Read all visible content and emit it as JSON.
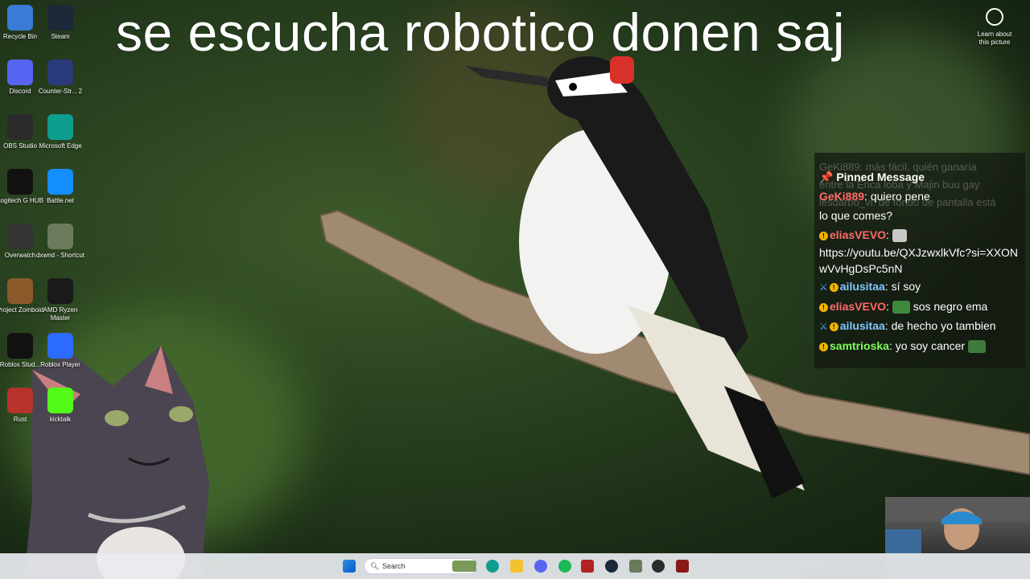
{
  "caption": "se escucha robotico donen saj",
  "learn_about": "Learn about this picture",
  "desktop_icons": [
    {
      "label": "Recycle Bin",
      "icon": "recycle-bin-icon",
      "color": "#3a7bd5"
    },
    {
      "label": "Steam",
      "icon": "steam-icon",
      "color": "#1b2838"
    },
    {
      "label": "Discord",
      "icon": "discord-icon",
      "color": "#5865f2"
    },
    {
      "label": "Counter-Str... 2",
      "icon": "counter-strike-icon",
      "color": "#2a3a7a"
    },
    {
      "label": "OBS Studio",
      "icon": "obs-icon",
      "color": "#2b2b2b"
    },
    {
      "label": "Microsoft Edge",
      "icon": "edge-icon",
      "color": "#0f9d8f"
    },
    {
      "label": "Logitech G HUB",
      "icon": "logitech-icon",
      "color": "#111111"
    },
    {
      "label": "Battle.net",
      "icon": "battlenet-icon",
      "color": "#148eff"
    },
    {
      "label": "Overwatch",
      "icon": "overwatch-icon",
      "color": "#333333"
    },
    {
      "label": "dxwnd - Shortcut",
      "icon": "dxwnd-icon",
      "color": "#6a7a5a"
    },
    {
      "label": "Project Zomboid",
      "icon": "zomboid-icon",
      "color": "#8a5a2a"
    },
    {
      "label": "AMD Ryzen Master",
      "icon": "ryzen-icon",
      "color": "#1a1a1a"
    },
    {
      "label": "Roblox Stud...",
      "icon": "roblox-studio-icon",
      "color": "#111111"
    },
    {
      "label": "Roblox Player",
      "icon": "roblox-icon",
      "color": "#2c6bff"
    },
    {
      "label": "Rust",
      "icon": "rust-icon",
      "color": "#b5332a"
    },
    {
      "label": "kicktalk",
      "icon": "kicktalk-icon",
      "color": "#53fc18"
    }
  ],
  "chat": {
    "ghost_lines": [
      "GeKi889: más fácil, quién ganaría",
      "entre la Erica loba y Majin buu gay",
      "lesdarbo_vi: de fondo de pantalla está"
    ],
    "pinned_label": "Pinned Message",
    "pinned_user": "GeKi889",
    "pinned_text": ": quiero pene",
    "continued": "lo que comes?",
    "messages": [
      {
        "user": "eliasVEVO",
        "user_color": "#ff6a6a",
        "text": ":",
        "has_sword": false
      },
      {
        "user": "",
        "user_color": "#ffffff",
        "text": "https://youtu.be/QXJzwxlkVfc?si=XXONwVvHgDsPc5nN",
        "has_sword": false
      },
      {
        "user": "ailusitaa",
        "user_color": "#7fc8ff",
        "text": ": sí soy",
        "has_sword": true
      },
      {
        "user": "eliasVEVO",
        "user_color": "#ff6a6a",
        "text": ": ",
        "after_emote": " sos negro ema",
        "has_sword": false
      },
      {
        "user": "ailusitaa",
        "user_color": "#7fc8ff",
        "text": ": de hecho yo tambien",
        "has_sword": true
      },
      {
        "user": "samtrioska",
        "user_color": "#7dff5a",
        "text": ": yo soy cancer",
        "has_sword": false
      }
    ]
  },
  "taskbar": {
    "search_placeholder": "Search"
  },
  "colors": {
    "pinned_user": "#ff6a6a",
    "taskbar_bg": "#e8ecf0"
  }
}
